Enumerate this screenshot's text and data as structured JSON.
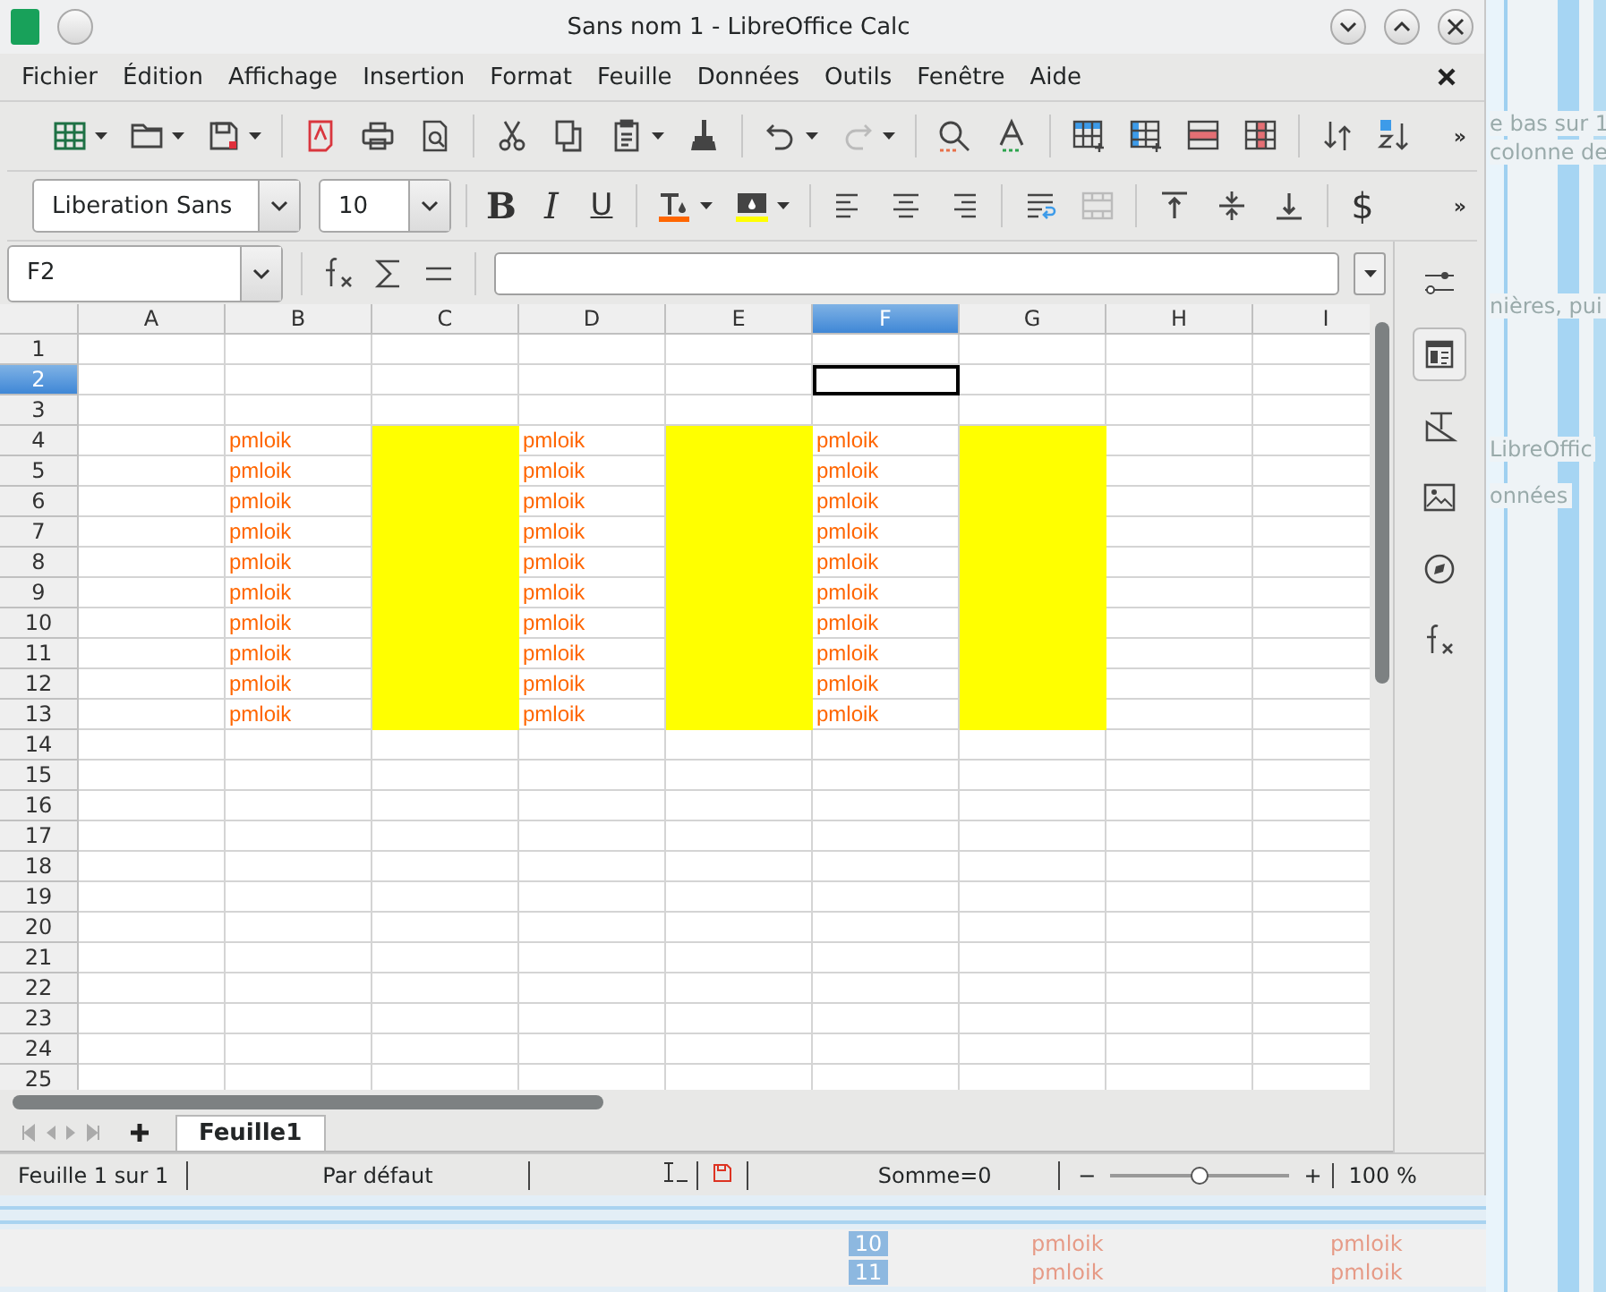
{
  "window": {
    "title": "Sans nom 1 - LibreOffice Calc"
  },
  "menu": [
    "Fichier",
    "Édition",
    "Affichage",
    "Insertion",
    "Format",
    "Feuille",
    "Données",
    "Outils",
    "Fenêtre",
    "Aide"
  ],
  "toolbar": [
    {
      "kind": "new-sheet",
      "dropdown": true
    },
    {
      "kind": "open",
      "dropdown": true
    },
    {
      "kind": "save",
      "dropdown": true
    },
    {
      "kind": "sep"
    },
    {
      "kind": "pdf"
    },
    {
      "kind": "print"
    },
    {
      "kind": "preview"
    },
    {
      "kind": "sep"
    },
    {
      "kind": "cut"
    },
    {
      "kind": "copy"
    },
    {
      "kind": "paste",
      "dropdown": true
    },
    {
      "kind": "brush"
    },
    {
      "kind": "sep"
    },
    {
      "kind": "undo",
      "dropdown": true
    },
    {
      "kind": "redo",
      "dropdown": true,
      "disabled": true
    },
    {
      "kind": "sep"
    },
    {
      "kind": "find"
    },
    {
      "kind": "spelling"
    },
    {
      "kind": "sep"
    },
    {
      "kind": "insert-rows"
    },
    {
      "kind": "insert-cols"
    },
    {
      "kind": "delete-rows"
    },
    {
      "kind": "delete-cols"
    },
    {
      "kind": "sep"
    },
    {
      "kind": "sort"
    },
    {
      "kind": "sort-az"
    }
  ],
  "toolbar_overflow": "»",
  "format_bar": {
    "overflow": "»",
    "font": "Liberation Sans",
    "size": "10",
    "items": [
      {
        "kind": "bold",
        "label": "B"
      },
      {
        "kind": "italic",
        "label": "I"
      },
      {
        "kind": "underline",
        "label": "U"
      },
      {
        "kind": "sep"
      },
      {
        "kind": "font-color",
        "dropdown": true
      },
      {
        "kind": "highlight",
        "dropdown": true
      },
      {
        "kind": "sep"
      },
      {
        "kind": "align-left"
      },
      {
        "kind": "align-center"
      },
      {
        "kind": "align-right"
      },
      {
        "kind": "sep"
      },
      {
        "kind": "wrap"
      },
      {
        "kind": "merge",
        "disabled": true
      },
      {
        "kind": "sep"
      },
      {
        "kind": "top"
      },
      {
        "kind": "middle"
      },
      {
        "kind": "bottom"
      },
      {
        "kind": "sep"
      },
      {
        "kind": "currency",
        "label": "$"
      }
    ]
  },
  "name_box": "F2",
  "columns": [
    {
      "label": "A",
      "selected": false
    },
    {
      "label": "B",
      "selected": false
    },
    {
      "label": "C",
      "selected": false
    },
    {
      "label": "D",
      "selected": false
    },
    {
      "label": "E",
      "selected": false
    },
    {
      "label": "F",
      "selected": true
    },
    {
      "label": "G",
      "selected": false
    },
    {
      "label": "H",
      "selected": false
    },
    {
      "label": "I",
      "selected": false
    }
  ],
  "rows": [
    {
      "label": "1",
      "selected": false
    },
    {
      "label": "2",
      "selected": true
    },
    {
      "label": "3",
      "selected": false
    },
    {
      "label": "4",
      "selected": false,
      "cells": [
        {},
        {
          "text": "pmloik"
        },
        {
          "highlighted": true
        },
        {
          "text": "pmloik"
        },
        {
          "highlighted": true
        },
        {
          "text": "pmloik"
        },
        {
          "highlighted": true
        }
      ]
    },
    {
      "label": "5",
      "selected": false,
      "cells": [
        {},
        {
          "text": "pmloik"
        },
        {
          "highlighted": true
        },
        {
          "text": "pmloik"
        },
        {
          "highlighted": true
        },
        {
          "text": "pmloik"
        },
        {
          "highlighted": true
        }
      ]
    },
    {
      "label": "6",
      "selected": false,
      "cells": [
        {},
        {
          "text": "pmloik"
        },
        {
          "highlighted": true
        },
        {
          "text": "pmloik"
        },
        {
          "highlighted": true
        },
        {
          "text": "pmloik"
        },
        {
          "highlighted": true
        }
      ]
    },
    {
      "label": "7",
      "selected": false,
      "cells": [
        {},
        {
          "text": "pmloik"
        },
        {
          "highlighted": true
        },
        {
          "text": "pmloik"
        },
        {
          "highlighted": true
        },
        {
          "text": "pmloik"
        },
        {
          "highlighted": true
        }
      ]
    },
    {
      "label": "8",
      "selected": false,
      "cells": [
        {},
        {
          "text": "pmloik"
        },
        {
          "highlighted": true
        },
        {
          "text": "pmloik"
        },
        {
          "highlighted": true
        },
        {
          "text": "pmloik"
        },
        {
          "highlighted": true
        }
      ]
    },
    {
      "label": "9",
      "selected": false,
      "cells": [
        {},
        {
          "text": "pmloik"
        },
        {
          "highlighted": true
        },
        {
          "text": "pmloik"
        },
        {
          "highlighted": true
        },
        {
          "text": "pmloik"
        },
        {
          "highlighted": true
        }
      ]
    },
    {
      "label": "10",
      "selected": false,
      "cells": [
        {},
        {
          "text": "pmloik"
        },
        {
          "highlighted": true
        },
        {
          "text": "pmloik"
        },
        {
          "highlighted": true
        },
        {
          "text": "pmloik"
        },
        {
          "highlighted": true
        }
      ]
    },
    {
      "label": "11",
      "selected": false,
      "cells": [
        {},
        {
          "text": "pmloik"
        },
        {
          "highlighted": true
        },
        {
          "text": "pmloik"
        },
        {
          "highlighted": true
        },
        {
          "text": "pmloik"
        },
        {
          "highlighted": true
        }
      ]
    },
    {
      "label": "12",
      "selected": false,
      "cells": [
        {},
        {
          "text": "pmloik"
        },
        {
          "highlighted": true
        },
        {
          "text": "pmloik"
        },
        {
          "highlighted": true
        },
        {
          "text": "pmloik"
        },
        {
          "highlighted": true
        }
      ]
    },
    {
      "label": "13",
      "selected": false,
      "cells": [
        {},
        {
          "text": "pmloik"
        },
        {
          "highlighted": true
        },
        {
          "text": "pmloik"
        },
        {
          "highlighted": true
        },
        {
          "text": "pmloik"
        },
        {
          "highlighted": true
        }
      ]
    },
    {
      "label": "14",
      "selected": false
    },
    {
      "label": "15",
      "selected": false
    },
    {
      "label": "16",
      "selected": false
    },
    {
      "label": "17",
      "selected": false
    },
    {
      "label": "18",
      "selected": false
    },
    {
      "label": "19",
      "selected": false
    },
    {
      "label": "20",
      "selected": false
    },
    {
      "label": "21",
      "selected": false
    },
    {
      "label": "22",
      "selected": false
    },
    {
      "label": "23",
      "selected": false
    },
    {
      "label": "24",
      "selected": false
    },
    {
      "label": "25",
      "selected": false
    }
  ],
  "sidebar": [
    {
      "kind": "properties-toggle",
      "selected": false
    },
    {
      "kind": "properties",
      "selected": true
    },
    {
      "kind": "styles",
      "selected": false
    },
    {
      "kind": "gallery",
      "selected": false
    },
    {
      "kind": "navigator",
      "selected": false
    },
    {
      "kind": "functions",
      "selected": false
    }
  ],
  "sheet_tabs": [
    {
      "label": "Feuille1",
      "selected": true
    }
  ],
  "status_bar": {
    "sheet": "Feuille 1 sur 1",
    "style": "Par défaut",
    "sum": "Somme=0",
    "zoom_minus": "−",
    "zoom_plus": "+",
    "zoom_slider": {
      "level": 0.5
    },
    "zoom": "100 %"
  },
  "background_window": {
    "side_texts": [
      "e bas sur 1",
      "colonne de",
      "nières, pui",
      "LibreOffic",
      "onnées"
    ],
    "rows": [
      {
        "number": "10",
        "cells": [
          "pmloik",
          "pmloik"
        ]
      },
      {
        "number": "11",
        "cells": [
          "pmloik",
          "pmloik"
        ]
      }
    ]
  }
}
